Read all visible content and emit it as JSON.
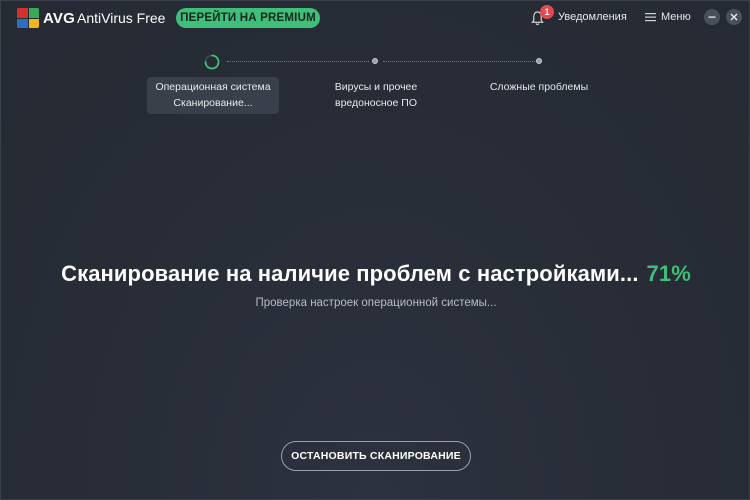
{
  "titlebar": {
    "brand": "AVG",
    "product": "AntiVirus Free",
    "premium_label": "ПЕРЕЙТИ НА PREMIUM",
    "notification_count": "1",
    "notifications_label": "Уведомления",
    "menu_label": "Меню"
  },
  "steps": [
    {
      "line1": "Операционная система",
      "line2": "Сканирование...",
      "state": "active"
    },
    {
      "line1": "Вирусы и прочее",
      "line2": "вредоносное ПО",
      "state": "pending"
    },
    {
      "line1": "Сложные проблемы",
      "line2": "",
      "state": "pending"
    }
  ],
  "main": {
    "title": "Сканирование на наличие проблем с настройками...",
    "percent": "71%",
    "subtitle": "Проверка настроек операционной системы...",
    "stop_label": "ОСТАНОВИТЬ СКАНИРОВАНИЕ"
  },
  "colors": {
    "accent": "#3fbf79",
    "background": "#272c36",
    "badge": "#e5484d",
    "logo_red": "#d2322d",
    "logo_green": "#3aa857",
    "logo_blue": "#2f6fc3",
    "logo_yellow": "#f2b71e"
  },
  "icons": {
    "logo": "avg-logo-icon",
    "bell": "bell-icon",
    "menu": "hamburger-menu-icon",
    "minimize": "minimize-icon",
    "close": "close-icon",
    "spinner": "spinner-icon"
  }
}
